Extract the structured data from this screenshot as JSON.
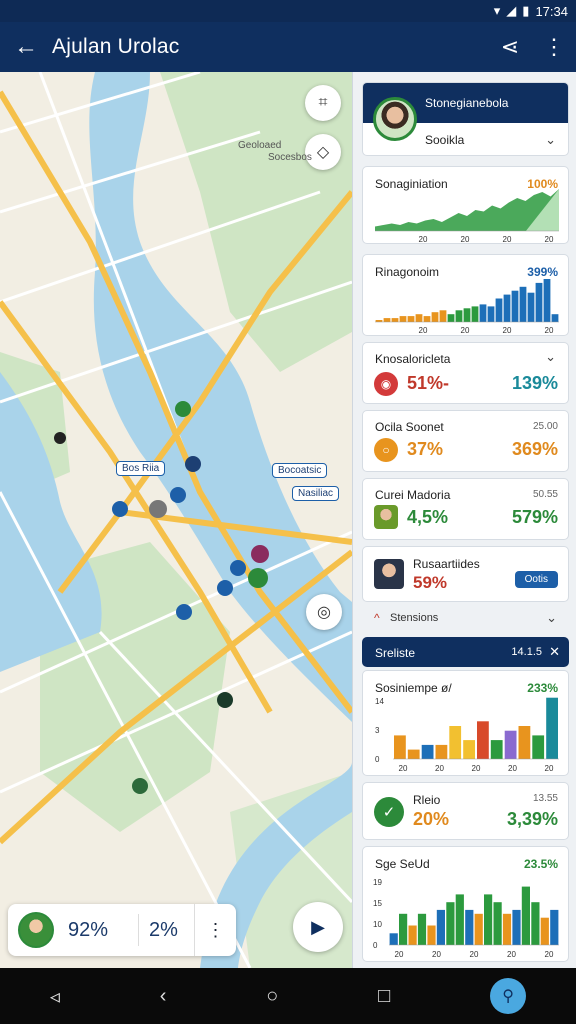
{
  "status_bar": {
    "time": "17:34",
    "icons": [
      "wifi-icon",
      "signal-icon",
      "battery-icon"
    ]
  },
  "app_bar": {
    "title": "Ajulan Urolac",
    "back_icon": "back-arrow-icon",
    "share_icon": "share-icon",
    "more_icon": "more-vert-icon"
  },
  "map": {
    "labels": [
      "Bos Riia",
      "Bocoatsic",
      "Nasiliac"
    ],
    "text_labels": [
      "Geoloaed",
      "Socesbos"
    ],
    "controls": [
      "crop-icon",
      "layers-icon",
      "locate-icon"
    ]
  },
  "map_stats": {
    "value1": "92%",
    "value2": "2%",
    "more_icon": "more-vert-icon",
    "play_icon": "play-icon"
  },
  "panel": {
    "profile": {
      "name": "Stonegianebola",
      "status": "Sooikla"
    },
    "card1": {
      "title": "Sonaginiation",
      "pct": "100%",
      "ticks": [
        "20",
        "20",
        "20",
        "20"
      ]
    },
    "card2": {
      "title": "Rinagonoim",
      "pct": "399%",
      "ticks": [
        "20",
        "20",
        "20",
        "20"
      ]
    },
    "card3": {
      "title": "Knosaloricleta",
      "value": "51%-",
      "value2": "139%"
    },
    "card4": {
      "title": "Ocila Soonet",
      "subtitle": "25.00",
      "value": "37%",
      "value2": "369%"
    },
    "card5": {
      "title": "Curei Madoria",
      "subtitle": "50.55",
      "value": "4,5%",
      "value2": "579%"
    },
    "card6": {
      "title": "Rusaartiides",
      "value": "59%",
      "button": "Ootis"
    },
    "section": {
      "label": "Stensions"
    },
    "card7": {
      "title": "Sreliste",
      "right": "14.1.5"
    },
    "card8": {
      "title": "Sosiniempe ø/",
      "pct": "233%",
      "yticks": [
        "14",
        "3",
        "0"
      ],
      "xticks": [
        "20",
        "20",
        "20",
        "20",
        "20"
      ]
    },
    "card9": {
      "title": "Rleio",
      "subtitle": "13.55",
      "value": "20%",
      "value2": "3,39%"
    },
    "card10": {
      "title": "Sge SeUd",
      "pct": "23.5%",
      "yticks": [
        "19",
        "15",
        "10",
        "0"
      ],
      "xticks": [
        "20",
        "20",
        "20",
        "20",
        "20"
      ]
    }
  },
  "chart_data": [
    {
      "type": "area",
      "title": "Sonaginiation",
      "series": [
        {
          "values": [
            3,
            4,
            5,
            4,
            6,
            5,
            7,
            8,
            6,
            9,
            12,
            10,
            14,
            13,
            17,
            15,
            19,
            22,
            20,
            24,
            26,
            23,
            28
          ]
        }
      ],
      "xticks": [
        "20",
        "20",
        "20",
        "20"
      ]
    },
    {
      "type": "bar",
      "title": "Rinagonoim",
      "series": [
        {
          "values": [
            1,
            2,
            2,
            3,
            3,
            4,
            3,
            5,
            6,
            4,
            6,
            7,
            8,
            9,
            8,
            12,
            14,
            16,
            18,
            15,
            20,
            22,
            4
          ]
        }
      ],
      "xticks": [
        "20",
        "20",
        "20",
        "20"
      ]
    },
    {
      "type": "bar",
      "title": "Sosiniempe ø/",
      "categories": [
        "1",
        "2",
        "3",
        "4",
        "5",
        "6",
        "7",
        "8",
        "9",
        "10",
        "11",
        "12"
      ],
      "series": [
        {
          "values": [
            5,
            2,
            3,
            3,
            7,
            4,
            8,
            4,
            6,
            7,
            5,
            13
          ]
        }
      ],
      "ylim": [
        0,
        14
      ]
    },
    {
      "type": "bar",
      "title": "Sge SeUd",
      "categories": [
        "1",
        "2",
        "3",
        "4",
        "5",
        "6",
        "7",
        "8",
        "9",
        "10",
        "11",
        "12",
        "13",
        "14",
        "15",
        "16",
        "17",
        "18"
      ],
      "series": [
        {
          "values": [
            3,
            8,
            5,
            8,
            5,
            9,
            11,
            13,
            9,
            8,
            13,
            11,
            8,
            9,
            15,
            11,
            7,
            9
          ]
        }
      ],
      "ylim": [
        0,
        19
      ]
    }
  ],
  "nav_bar": {
    "icons": [
      "nav-back-icon",
      "home-icon",
      "recents-icon",
      "assistant-icon"
    ]
  }
}
